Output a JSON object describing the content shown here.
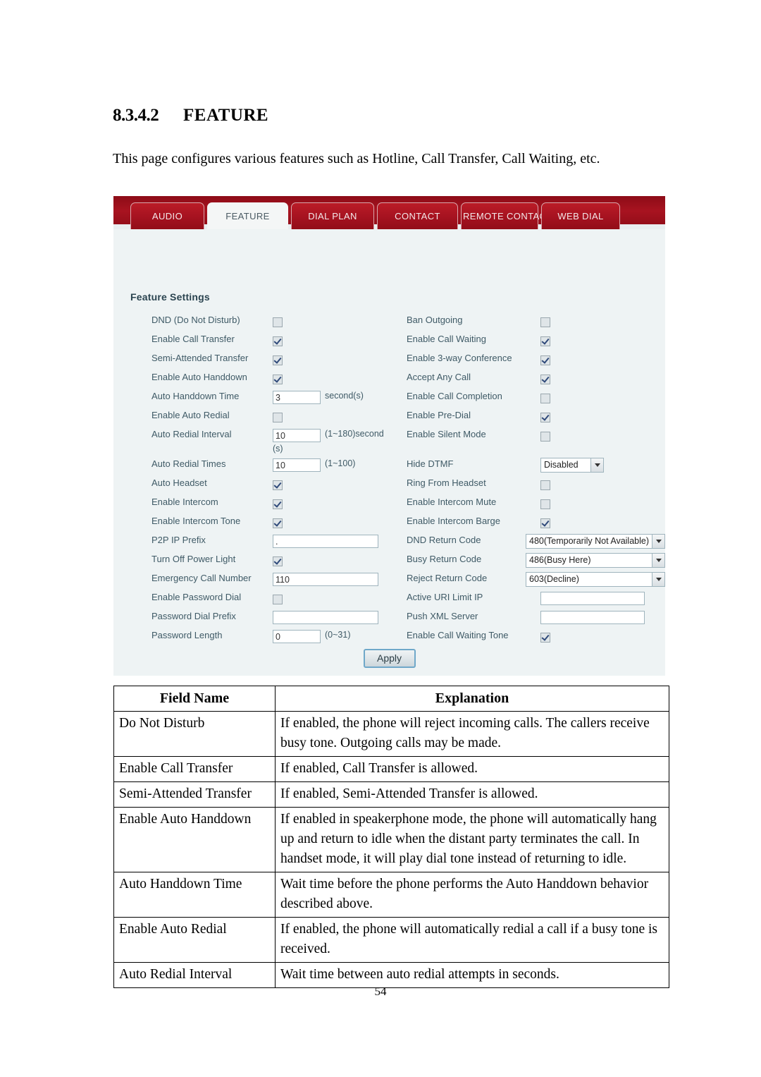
{
  "document": {
    "section_number": "8.3.4.2",
    "section_title": "FEATURE",
    "intro": "This page configures various features such as Hotline, Call Transfer, Call Waiting, etc.",
    "page_number": "54"
  },
  "screenshot": {
    "tabs": [
      {
        "label": "AUDIO",
        "active": false
      },
      {
        "label": "FEATURE",
        "active": true
      },
      {
        "label": "DIAL PLAN",
        "active": false
      },
      {
        "label": "CONTACT",
        "active": false
      },
      {
        "label": "REMOTE CONTACT",
        "active": false
      },
      {
        "label": "WEB DIAL",
        "active": false
      }
    ],
    "section_heading": "Feature Settings",
    "apply_label": "Apply",
    "rows": [
      {
        "left": {
          "label": "DND (Do Not Disturb)",
          "type": "checkbox",
          "checked": false
        },
        "right": {
          "label": "Ban Outgoing",
          "type": "checkbox",
          "checked": false
        }
      },
      {
        "left": {
          "label": "Enable Call Transfer",
          "type": "checkbox",
          "checked": true
        },
        "right": {
          "label": "Enable Call Waiting",
          "type": "checkbox",
          "checked": true
        }
      },
      {
        "left": {
          "label": "Semi-Attended Transfer",
          "type": "checkbox",
          "checked": true
        },
        "right": {
          "label": "Enable 3-way Conference",
          "type": "checkbox",
          "checked": true
        }
      },
      {
        "left": {
          "label": "Enable Auto Handdown",
          "type": "checkbox",
          "checked": true
        },
        "right": {
          "label": "Accept Any Call",
          "type": "checkbox",
          "checked": true
        }
      },
      {
        "left": {
          "label": "Auto Handdown Time",
          "type": "text",
          "value": "3",
          "hint": "second(s)",
          "width": "small"
        },
        "right": {
          "label": "Enable Call Completion",
          "type": "checkbox",
          "checked": false
        }
      },
      {
        "left": {
          "label": "Enable Auto Redial",
          "type": "checkbox",
          "checked": false
        },
        "right": {
          "label": "Enable Pre-Dial",
          "type": "checkbox",
          "checked": true
        }
      },
      {
        "left": {
          "label": "Auto Redial Interval",
          "type": "text",
          "value": "10",
          "hint": "(1~180)second",
          "hint2": "(s)",
          "width": "small"
        },
        "right": {
          "label": "Enable Silent Mode",
          "type": "checkbox",
          "checked": false
        }
      },
      {
        "left": {
          "label": "Auto Redial Times",
          "type": "text",
          "value": "10",
          "hint": "(1~100)",
          "width": "small"
        },
        "right": {
          "label": "Hide DTMF",
          "type": "select",
          "value": "Disabled",
          "width": "dtmf"
        }
      },
      {
        "left": {
          "label": "Auto Headset",
          "type": "checkbox",
          "checked": true
        },
        "right": {
          "label": "Ring From Headset",
          "type": "checkbox",
          "checked": false
        }
      },
      {
        "left": {
          "label": "Enable Intercom",
          "type": "checkbox",
          "checked": true
        },
        "right": {
          "label": "Enable Intercom Mute",
          "type": "checkbox",
          "checked": false
        }
      },
      {
        "left": {
          "label": "Enable Intercom Tone",
          "type": "checkbox",
          "checked": true
        },
        "right": {
          "label": "Enable Intercom Barge",
          "type": "checkbox",
          "checked": true
        }
      },
      {
        "left": {
          "label": "P2P IP Prefix",
          "type": "text",
          "value": ".",
          "width": "wide"
        },
        "right": {
          "label": "DND Return Code",
          "type": "select",
          "value": "480(Temporarily Not Available)",
          "width": "code"
        }
      },
      {
        "left": {
          "label": "Turn Off Power Light",
          "type": "checkbox",
          "checked": true
        },
        "right": {
          "label": "Busy Return Code",
          "type": "select",
          "value": "486(Busy Here)",
          "width": "code"
        }
      },
      {
        "left": {
          "label": "Emergency Call Number",
          "type": "text",
          "value": "110",
          "width": "wide"
        },
        "right": {
          "label": "Reject Return Code",
          "type": "select",
          "value": "603(Decline)",
          "width": "code"
        }
      },
      {
        "left": {
          "label": "Enable Password Dial",
          "type": "checkbox",
          "checked": false
        },
        "right": {
          "label": "Active URI Limit IP",
          "type": "text",
          "value": "",
          "width": "rwide"
        }
      },
      {
        "left": {
          "label": "Password Dial Prefix",
          "type": "text",
          "value": "",
          "width": "wide"
        },
        "right": {
          "label": "Push XML Server",
          "type": "text",
          "value": "",
          "width": "rwide"
        }
      },
      {
        "left": {
          "label": "Password Length",
          "type": "text",
          "value": "0",
          "hint": "(0~31)",
          "width": "small"
        },
        "right": {
          "label": "Enable Call Waiting Tone",
          "type": "checkbox",
          "checked": true
        }
      }
    ]
  },
  "explanation_table": {
    "headers": [
      "Field Name",
      "Explanation"
    ],
    "rows": [
      {
        "field": "Do Not Disturb",
        "explanation": "If enabled, the phone will reject incoming calls.    The callers receive busy tone.    Outgoing calls may be made."
      },
      {
        "field": "Enable Call Transfer",
        "explanation": "If enabled, Call Transfer is allowed."
      },
      {
        "field": "Semi-Attended Transfer",
        "explanation": "If enabled, Semi-Attended Transfer is allowed."
      },
      {
        "field": "Enable Auto Handdown",
        "explanation": "If enabled in speakerphone mode, the phone will automatically hang up and return to idle when the distant party terminates the call.    In handset mode, it will play dial tone instead of returning to idle."
      },
      {
        "field": "Auto Handdown Time",
        "explanation": "Wait time before the phone performs the Auto Handdown behavior described above."
      },
      {
        "field": "Enable Auto Redial",
        "explanation": "If enabled, the phone will automatically redial a call if a busy tone is received."
      },
      {
        "field": "Auto Redial Interval",
        "explanation": "Wait time between auto redial attempts in seconds."
      }
    ]
  }
}
